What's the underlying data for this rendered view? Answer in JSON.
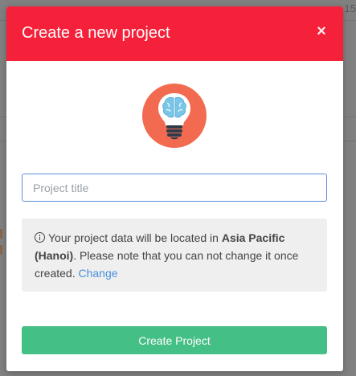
{
  "background": {
    "corner_number": "15"
  },
  "modal": {
    "title": "Create a new project",
    "close_glyph": "×",
    "illustration_icon": "lightbulb-brain-icon",
    "title_input": {
      "value": "",
      "placeholder": "Project title"
    },
    "info": {
      "icon": "info-circle-icon",
      "text_prefix": "Your project data will be located in ",
      "region": "Asia Pacific (Hanoi)",
      "text_suffix": ". Please note that you can not change it once created. ",
      "change_link": "Change"
    },
    "create_button": "Create Project"
  },
  "colors": {
    "header": "#f5213a",
    "primary_button": "#44bf85",
    "link": "#4a8fdc",
    "input_border": "#5b8fd6",
    "icon_circle": "#f26b50"
  }
}
